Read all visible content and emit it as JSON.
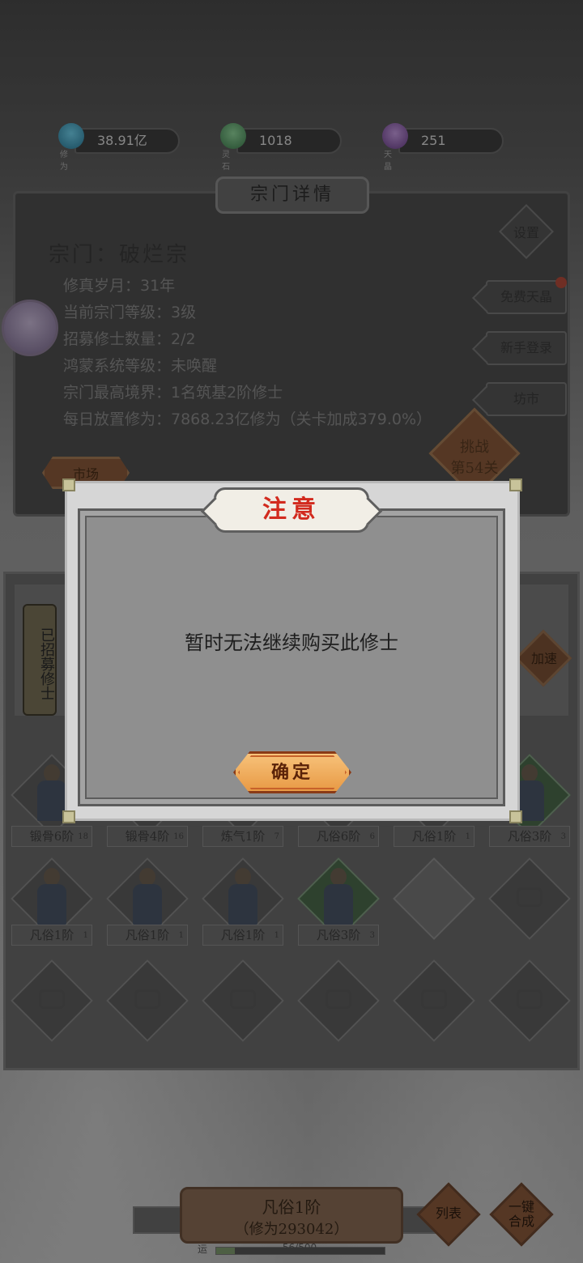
{
  "resources": [
    {
      "name": "修为",
      "value": "38.91亿",
      "color": "#4aa8c8",
      "icon": "cultivation-flame-icon"
    },
    {
      "name": "灵石",
      "value": "1018",
      "color": "#5aa06a",
      "icon": "spirit-stone-icon"
    },
    {
      "name": "天晶",
      "value": "251",
      "color": "#8a5aa8",
      "icon": "heaven-crystal-icon"
    }
  ],
  "sect": {
    "panel_title": "宗门详情",
    "name_line": "宗门：破烂宗",
    "details": [
      "修真岁月：31年",
      "当前宗门等级：3级",
      "招募修士数量：2/2",
      "鸿蒙系统等级：未唤醒",
      "宗门最高境界：1名筑基2阶修士",
      "每日放置修为：7868.23亿修为（关卡加成379.0%）"
    ],
    "settings_label": "设置",
    "side_buttons": [
      "免费天晶",
      "新手登录",
      "坊市"
    ],
    "challenge_label_1": "挑战",
    "challenge_label_2": "第54关",
    "market_label": "市场"
  },
  "recruit": {
    "recruited_tab": "已招募修士",
    "speed_label": "加速",
    "row1": [
      {
        "label": "锻骨6阶",
        "count": "18",
        "type": "char"
      },
      {
        "label": "锻骨4阶",
        "count": "16",
        "type": "char"
      },
      {
        "label": "炼气1阶",
        "count": "7",
        "type": "char"
      },
      {
        "label": "凡俗6阶",
        "count": "6",
        "type": "char"
      },
      {
        "label": "凡俗1阶",
        "count": "1",
        "type": "char"
      },
      {
        "label": "凡俗3阶",
        "count": "3",
        "type": "char-green"
      }
    ],
    "row2": [
      {
        "label": "凡俗1阶",
        "count": "1",
        "type": "char"
      },
      {
        "label": "凡俗1阶",
        "count": "1",
        "type": "char"
      },
      {
        "label": "凡俗1阶",
        "count": "1",
        "type": "char"
      },
      {
        "label": "凡俗3阶",
        "count": "3",
        "type": "char-green"
      },
      {
        "label": "",
        "count": "",
        "type": "empty"
      },
      {
        "label": "",
        "count": "",
        "type": "locked"
      }
    ],
    "row3": [
      "locked",
      "locked",
      "locked",
      "locked",
      "locked",
      "locked"
    ]
  },
  "bottom": {
    "current_rank": "凡俗1阶",
    "cultivation_cost": "（修为293042）",
    "list_button": "列表",
    "merge_button_1": "一键",
    "merge_button_2": "合成",
    "progress_label": "运",
    "progress_text": "56/500",
    "progress_fraction": 0.112
  },
  "dialog": {
    "title": "注意",
    "message": "暂时无法继续购买此修士",
    "confirm_label": "确定"
  }
}
